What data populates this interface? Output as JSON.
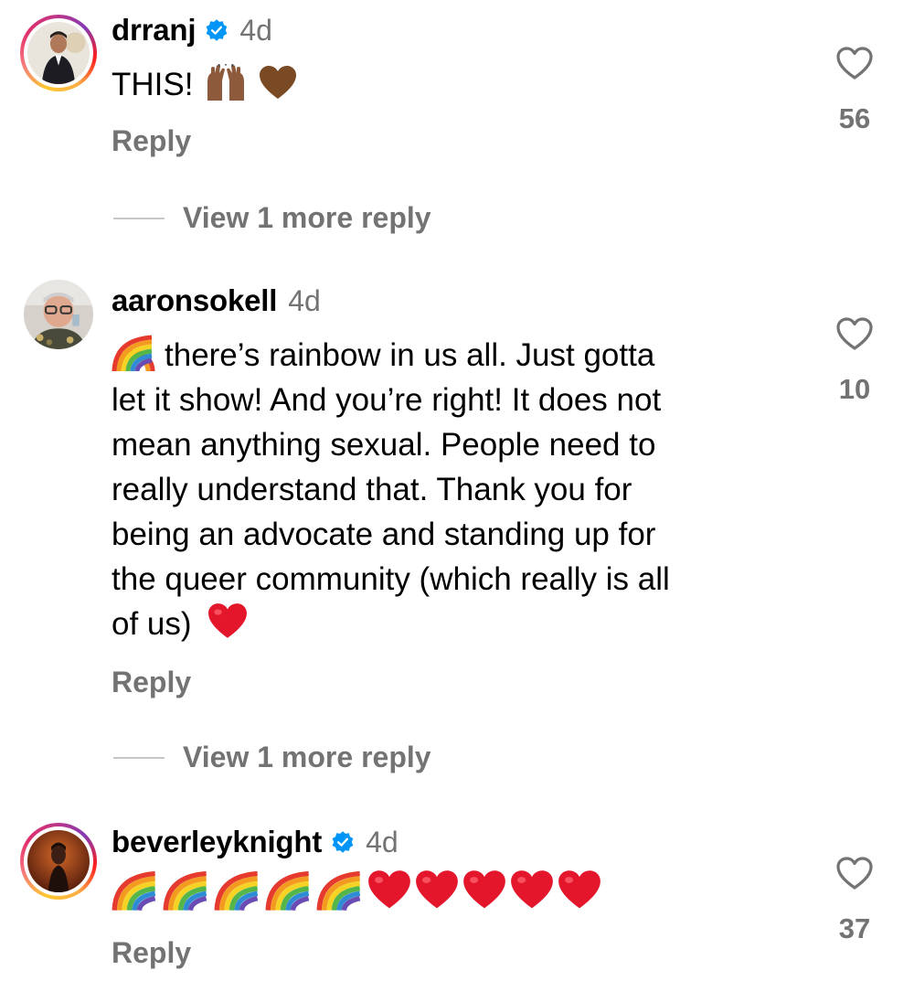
{
  "comments": [
    {
      "username": "drranj",
      "verified": true,
      "time": "4d",
      "text": "THIS!",
      "emoji_after_text": [
        "raising-hands-emoji",
        "brown-heart-emoji"
      ],
      "reply_label": "Reply",
      "likes": "56",
      "view_replies_label": "View 1 more reply"
    },
    {
      "username": "aaronsokell",
      "verified": false,
      "time": "4d",
      "text_lines": [
        "there’s rainbow in us all. Just gotta",
        "let it show! And you’re right! It does not",
        "mean anything sexual. People need to",
        "really understand that. Thank you for",
        "being an advocate and standing up for",
        "the queer community (which really is all",
        "of us)"
      ],
      "emoji_before_text": "rainbow-emoji",
      "emoji_after_text": "red-heart-emoji",
      "reply_label": "Reply",
      "likes": "10",
      "view_replies_label": "View 1 more reply"
    },
    {
      "username": "beverleyknight",
      "verified": true,
      "time": "4d",
      "emoji_sequence": [
        "rainbow-emoji",
        "rainbow-emoji",
        "rainbow-emoji",
        "rainbow-emoji",
        "rainbow-emoji",
        "red-heart-emoji",
        "red-heart-emoji",
        "red-heart-emoji",
        "red-heart-emoji",
        "red-heart-emoji"
      ],
      "reply_label": "Reply",
      "likes": "37"
    }
  ],
  "colors": {
    "secondary_text": "#737373",
    "verified_blue": "#0095f6",
    "divider": "#c7c7c7"
  }
}
